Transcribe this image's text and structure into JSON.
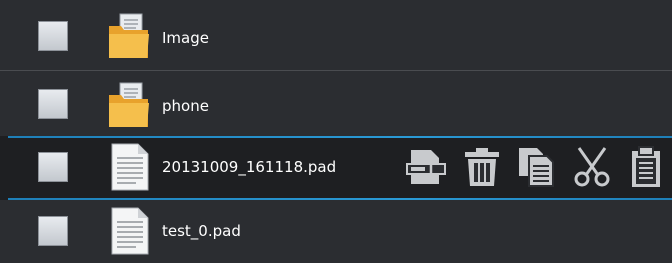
{
  "files": [
    {
      "name": "Image",
      "type": "folder",
      "checked": false,
      "icon": "folder-icon"
    },
    {
      "name": "phone",
      "type": "folder",
      "checked": false,
      "icon": "folder-icon"
    },
    {
      "name": "20131009_161118.pad",
      "type": "file",
      "checked": false,
      "selected": true,
      "icon": "document-icon"
    },
    {
      "name": "test_0.pad",
      "type": "file",
      "checked": false,
      "icon": "document-icon"
    }
  ],
  "row_actions": [
    {
      "name": "rename",
      "icon": "rename-icon"
    },
    {
      "name": "delete",
      "icon": "trash-icon"
    },
    {
      "name": "copy",
      "icon": "copy-icon"
    },
    {
      "name": "cut",
      "icon": "scissors-icon"
    },
    {
      "name": "paste",
      "icon": "clipboard-icon"
    }
  ],
  "colors": {
    "background": "#2b2d31",
    "selected_row": "#1e1f22",
    "selection_line": "#2a9ad6",
    "folder": "#f0b43c",
    "text": "#ffffff",
    "action_icon": "#c8cacd"
  }
}
